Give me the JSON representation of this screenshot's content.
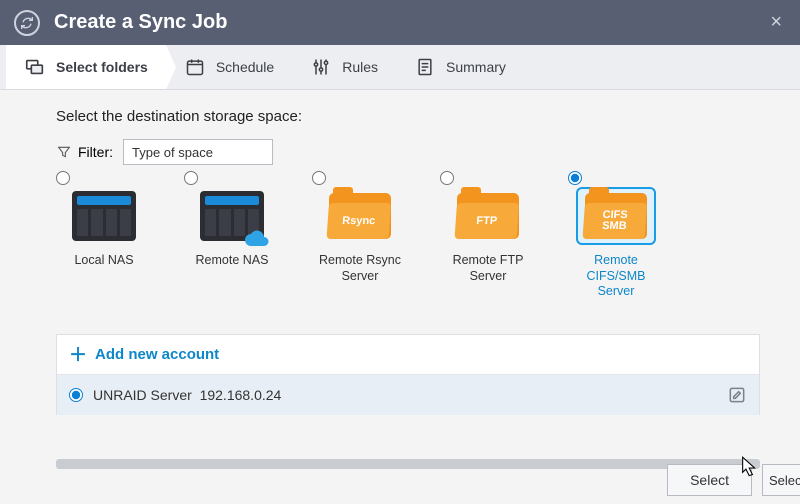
{
  "window": {
    "title": "Create a Sync Job"
  },
  "steps": {
    "select_folders": "Select folders",
    "schedule": "Schedule",
    "rules": "Rules",
    "summary": "Summary"
  },
  "section": {
    "heading": "Select the destination storage space:"
  },
  "filter": {
    "label": "Filter:",
    "value": "Type of space"
  },
  "spaces": {
    "local_nas": "Local NAS",
    "remote_nas": "Remote NAS",
    "remote_rsync": "Remote Rsync Server",
    "remote_ftp": "Remote FTP Server",
    "remote_cifs": "Remote CIFS/SMB Server",
    "folder_rsync_tag": "Rsync",
    "folder_ftp_tag": "FTP",
    "folder_cifs_tag": "CIFS\nSMB"
  },
  "accounts": {
    "add_label": "Add new account",
    "items": [
      {
        "name": "UNRAID Server",
        "address": "192.168.0.24",
        "selected": true
      }
    ]
  },
  "buttons": {
    "select": "Select",
    "select_partial": "Selec"
  }
}
